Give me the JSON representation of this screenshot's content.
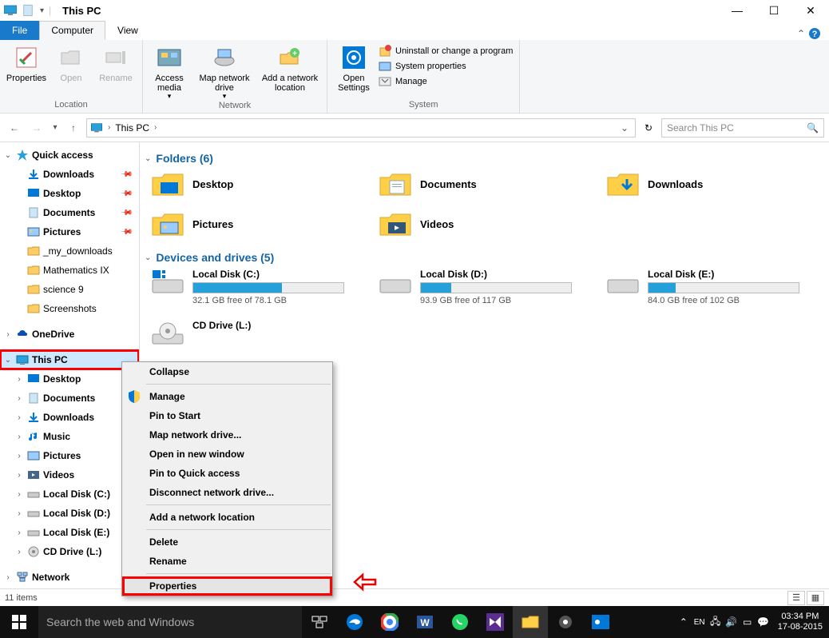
{
  "window": {
    "title": "This PC",
    "tabs": {
      "file": "File",
      "computer": "Computer",
      "view": "View"
    }
  },
  "ribbon": {
    "location": {
      "label": "Location",
      "properties": "Properties",
      "open": "Open",
      "rename": "Rename"
    },
    "network": {
      "label": "Network",
      "access_media": "Access media",
      "map_drive": "Map network drive",
      "add_location": "Add a network location"
    },
    "open_settings": "Open Settings",
    "system": {
      "label": "System",
      "uninstall": "Uninstall or change a program",
      "sys_props": "System properties",
      "manage": "Manage"
    }
  },
  "addressbar": {
    "crumb": "This PC"
  },
  "search": {
    "placeholder": "Search This PC"
  },
  "sidebar": {
    "quick_access": "Quick access",
    "qa_items": [
      "Downloads",
      "Desktop",
      "Documents",
      "Pictures",
      "_my_downloads",
      "Mathematics IX",
      "science 9",
      "Screenshots"
    ],
    "onedrive": "OneDrive",
    "this_pc": "This PC",
    "pc_items": [
      "Desktop",
      "Documents",
      "Downloads",
      "Music",
      "Pictures",
      "Videos",
      "Local Disk (C:)",
      "Local Disk (D:)",
      "Local Disk (E:)",
      "CD Drive (L:)"
    ],
    "network": "Network"
  },
  "content": {
    "folders_header": "Folders (6)",
    "folders": [
      "Desktop",
      "Documents",
      "Downloads",
      "Pictures",
      "Videos"
    ],
    "drives_header": "Devices and drives (5)",
    "drives": [
      {
        "name": "Local Disk (C:)",
        "free_text": "32.1 GB free of 78.1 GB",
        "fill_pct": 59
      },
      {
        "name": "Local Disk (D:)",
        "free_text": "93.9 GB free of 117 GB",
        "fill_pct": 20
      },
      {
        "name": "Local Disk (E:)",
        "free_text": "84.0 GB free of 102 GB",
        "fill_pct": 18
      },
      {
        "name": "CD Drive (L:)",
        "free_text": "",
        "fill_pct": 0
      }
    ]
  },
  "context_menu": {
    "items": [
      "Collapse",
      "Manage",
      "Pin to Start",
      "Map network drive...",
      "Open in new window",
      "Pin to Quick access",
      "Disconnect network drive...",
      "Add a network location",
      "Delete",
      "Rename",
      "Properties"
    ]
  },
  "statusbar": {
    "text": "11 items"
  },
  "taskbar": {
    "search_placeholder": "Search the web and Windows",
    "clock_time": "03:34 PM",
    "clock_date": "17-08-2015"
  }
}
